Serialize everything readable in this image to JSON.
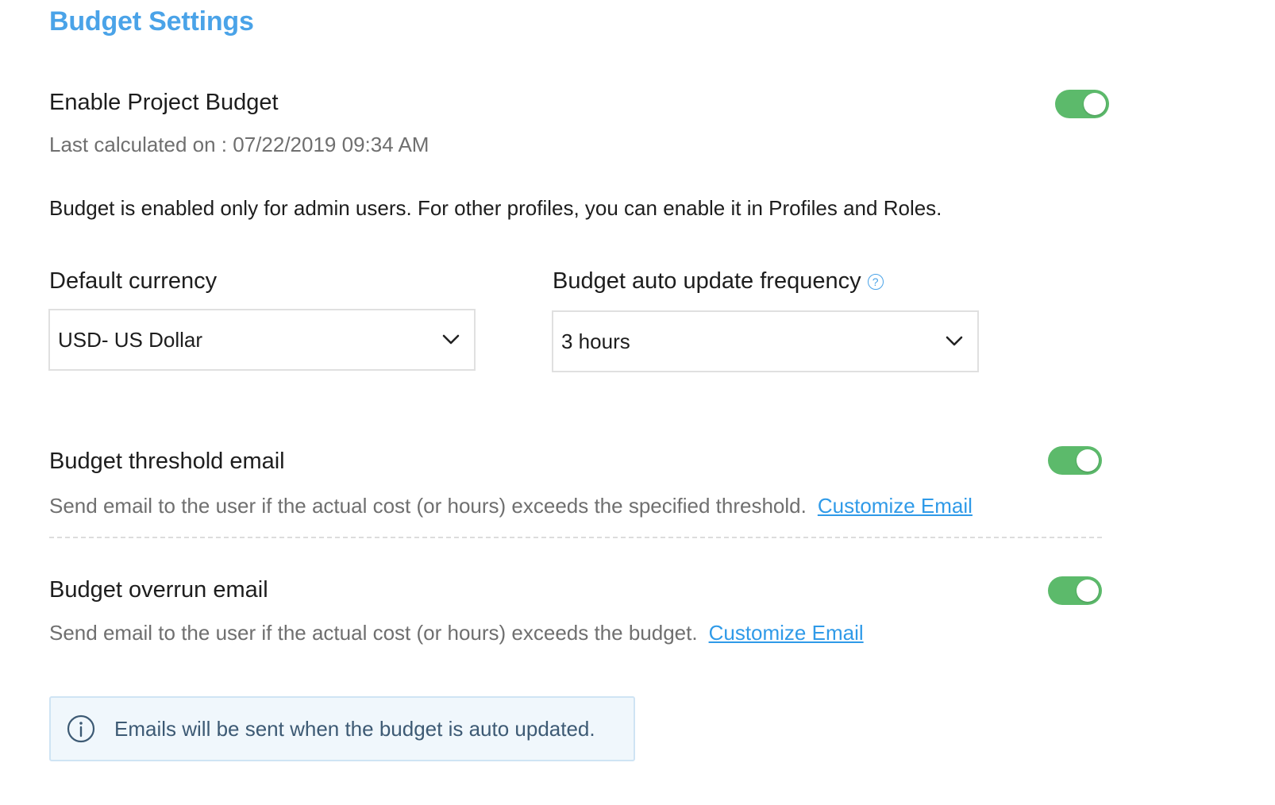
{
  "title": "Budget Settings",
  "enable_project_budget": {
    "label": "Enable Project Budget",
    "enabled": true,
    "last_calculated": "Last calculated on : 07/22/2019 09:34 AM",
    "note": "Budget is enabled only for admin users. For other profiles, you can enable it in Profiles and Roles."
  },
  "default_currency": {
    "label": "Default currency",
    "value": "USD- US Dollar"
  },
  "auto_update_frequency": {
    "label": "Budget auto update frequency",
    "value": "3 hours",
    "help_icon": "question-circle-icon"
  },
  "threshold_email": {
    "label": "Budget threshold email",
    "enabled": true,
    "description": "Send email to the user if the actual cost (or hours) exceeds the specified threshold.",
    "link": "Customize Email"
  },
  "overrun_email": {
    "label": "Budget overrun email",
    "enabled": true,
    "description": "Send email to the user if the actual cost (or hours) exceeds the budget.",
    "link": "Customize Email"
  },
  "info": {
    "icon": "info-circle-icon",
    "text": "Emails will be sent when the budget is auto updated."
  },
  "colors": {
    "accent": "#4aa3e8",
    "toggle_on": "#5cba6b",
    "link": "#2f9ae8",
    "info_bg": "#f0f7fc"
  }
}
